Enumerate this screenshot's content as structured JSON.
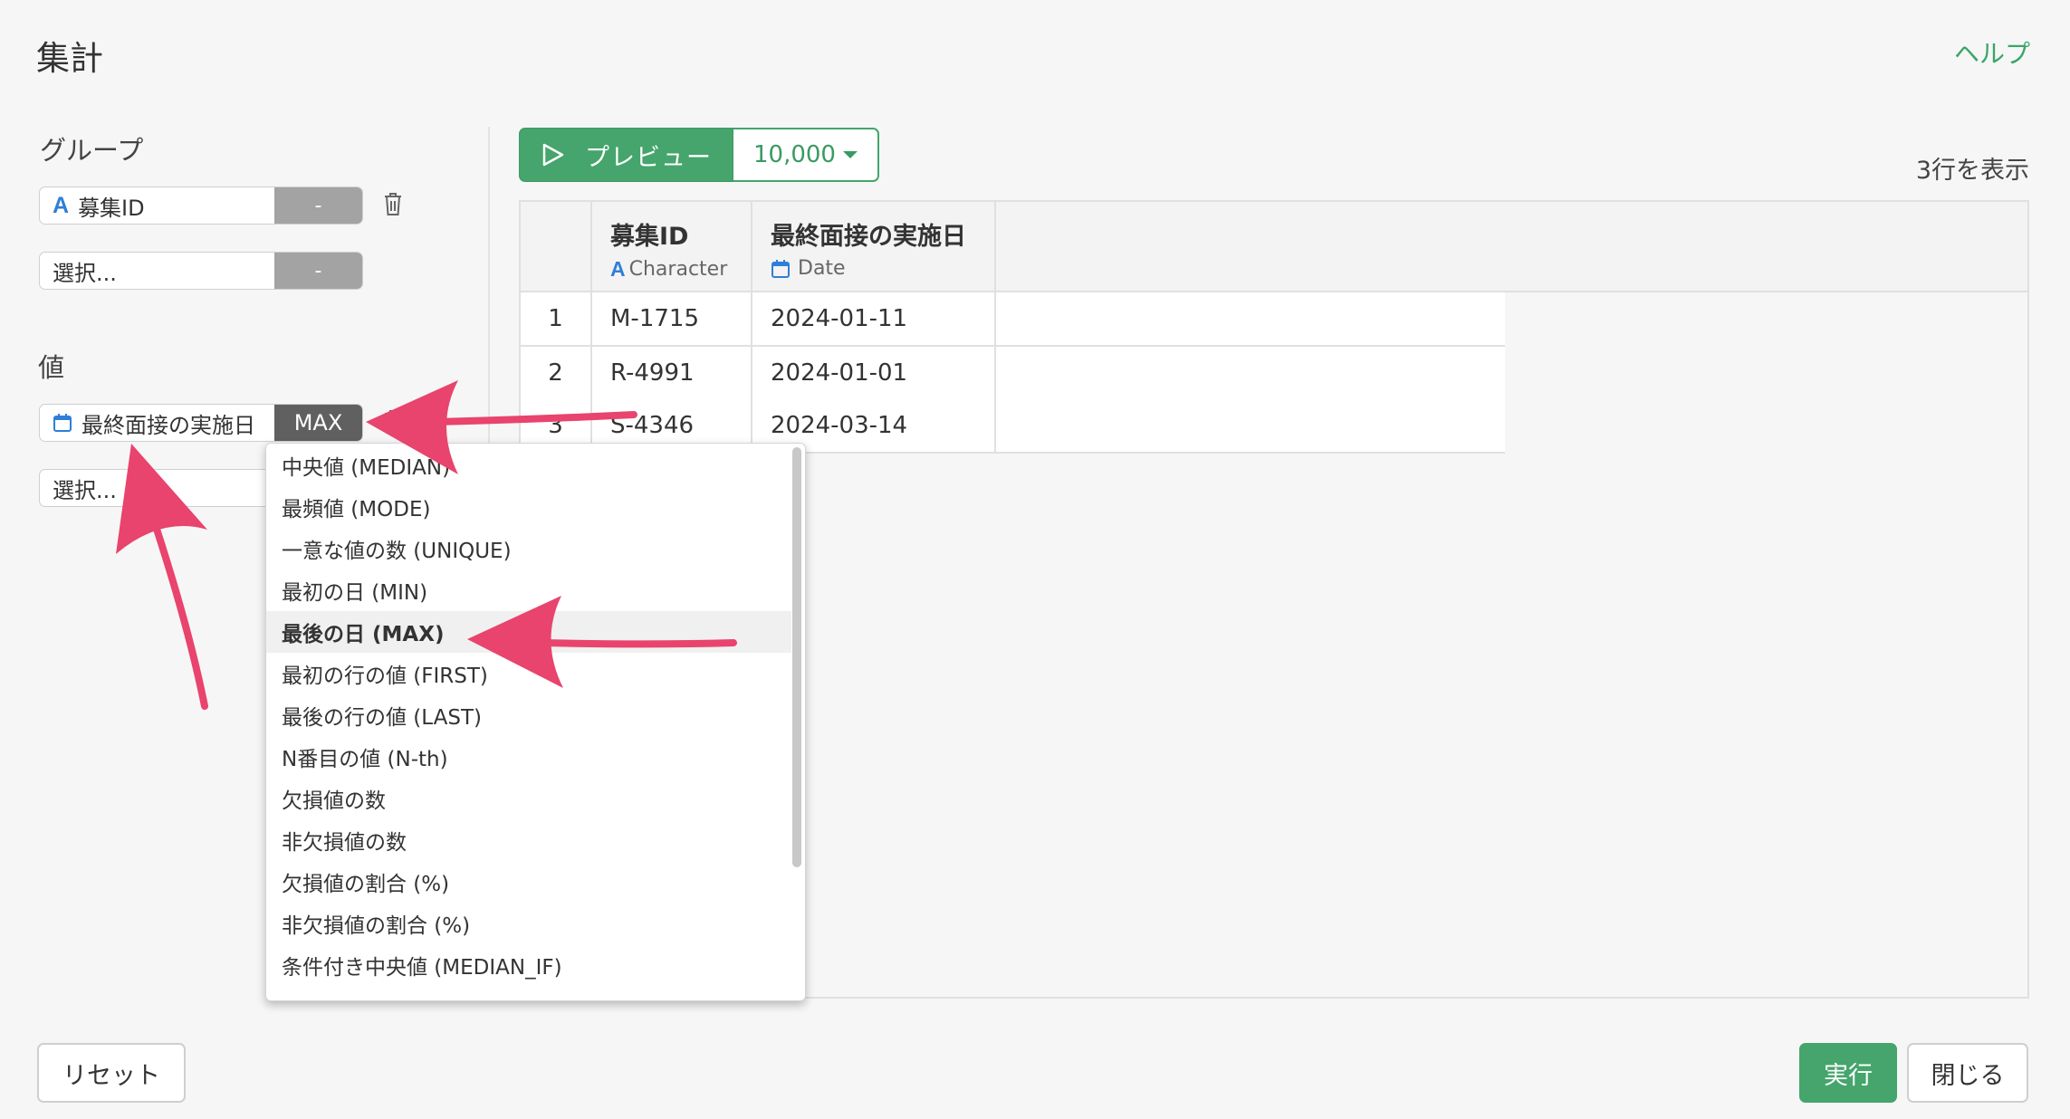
{
  "dialog": {
    "title": "集計",
    "help": "ヘルプ"
  },
  "group": {
    "label": "グループ",
    "items": [
      {
        "field": "募集ID",
        "op": "-"
      },
      {
        "field": "選択...",
        "op": "-"
      }
    ]
  },
  "values": {
    "label": "値",
    "items": [
      {
        "field": "最終面接の実施日",
        "op": "MAX"
      },
      {
        "field": "選択..."
      }
    ]
  },
  "preview": {
    "button": "プレビュー",
    "rows": "10,000",
    "row_count": "3行を表示"
  },
  "table": {
    "columns": [
      {
        "name": "募集ID",
        "type": "Character",
        "type_icon": "A"
      },
      {
        "name": "最終面接の実施日",
        "type": "Date",
        "type_icon": "calendar-icon"
      }
    ],
    "rows": [
      {
        "index": "1",
        "id": "M-1715",
        "date": "2024-01-11"
      },
      {
        "index": "2",
        "id": "R-4991",
        "date": "2024-01-01"
      },
      {
        "index": "3",
        "id": "S-4346",
        "date": "2024-03-14"
      }
    ]
  },
  "dropdown": {
    "selected_index": 4,
    "items": [
      "中央値 (MEDIAN)",
      "最頻値 (MODE)",
      "一意な値の数 (UNIQUE)",
      "最初の日 (MIN)",
      "最後の日 (MAX)",
      "最初の行の値 (FIRST)",
      "最後の行の値 (LAST)",
      "N番目の値 (N-th)",
      "欠損値の数",
      "非欠損値の数",
      "欠損値の割合 (%)",
      "非欠損値の割合 (%)",
      "条件付き中央値 (MEDIAN_IF)"
    ]
  },
  "footer": {
    "reset": "リセット",
    "run": "実行",
    "close": "閉じる"
  },
  "colors": {
    "accent": "#45a56c",
    "arrow": "#e8446d",
    "type_icon": "#2f7fd6"
  }
}
